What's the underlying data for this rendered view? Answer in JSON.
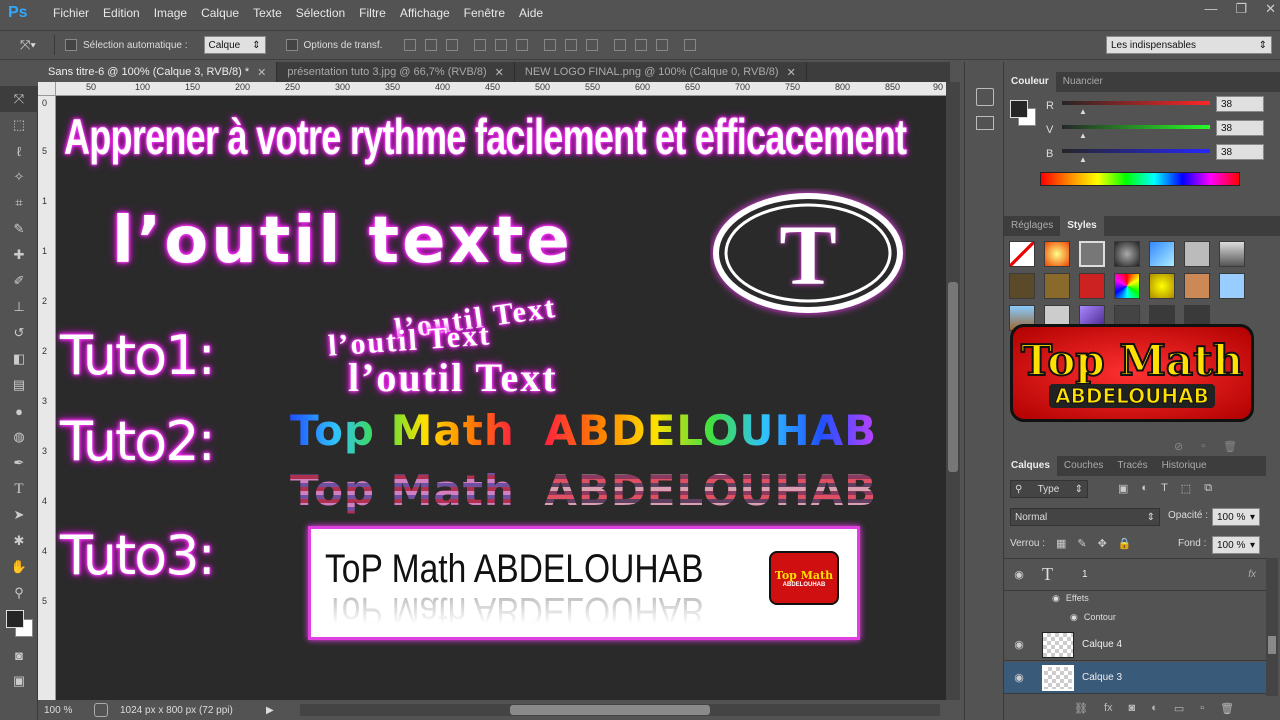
{
  "app": {
    "logo": "Ps"
  },
  "menu": [
    "Fichier",
    "Edition",
    "Image",
    "Calque",
    "Texte",
    "Sélection",
    "Filtre",
    "Affichage",
    "Fenêtre",
    "Aide"
  ],
  "window_controls": [
    "—",
    "❐",
    "✕"
  ],
  "options": {
    "auto_select_label": "Sélection automatique :",
    "auto_select_value": "Calque",
    "transform_label": "Options de transf.",
    "workspace": "Les indispensables"
  },
  "doc_tabs": [
    {
      "label": "Sans titre-6 @ 100% (Calque 3, RVB/8) *",
      "close": "✕",
      "active": true
    },
    {
      "label": "présentation tuto 3.jpg @ 66,7% (RVB/8)",
      "close": "✕",
      "active": false
    },
    {
      "label": "NEW LOGO FINAL.png @ 100% (Calque 0, RVB/8)",
      "close": "✕",
      "active": false
    }
  ],
  "ruler_h": [
    "50",
    "100",
    "150",
    "200",
    "250",
    "300",
    "350",
    "400",
    "450",
    "500",
    "550",
    "600",
    "650",
    "700",
    "750",
    "800",
    "850",
    "90"
  ],
  "ruler_v": [
    "0",
    "5",
    "1",
    "1",
    "2",
    "2",
    "3",
    "3",
    "4",
    "4",
    "5"
  ],
  "canvas": {
    "headline": "Apprener à votre rythme facilement et efficacement",
    "subtitle": "l’outil texte",
    "logo_letter": "T",
    "tuto1": "Tuto1:",
    "tuto2": "Tuto2:",
    "tuto3": "Tuto3:",
    "arc_texts": [
      "l’outil Text",
      "l’outil Text",
      "l’outil Text"
    ],
    "rainbow_top": "Top Math",
    "rainbow_name": "ABDELOUHAB",
    "pattern_top": "Top Math",
    "pattern_name": "ABDELOUHAB",
    "reflect_text": "ToP Math ABDELOUHAB",
    "mini_logo_top": "Top Math",
    "mini_logo_name": "ABDELOUHAB"
  },
  "status": {
    "zoom": "100 %",
    "doc_size": "1024 px x 800 px (72 ppi)"
  },
  "color_panel": {
    "tabs": [
      "Couleur",
      "Nuancier"
    ],
    "channels": [
      {
        "label": "R",
        "value": "38"
      },
      {
        "label": "V",
        "value": "38"
      },
      {
        "label": "B",
        "value": "38"
      }
    ]
  },
  "styles_panel": {
    "tabs": [
      "Réglages",
      "Styles"
    ]
  },
  "preview_logo": {
    "line1": "Top Math",
    "line2": "ABDELOUHAB"
  },
  "layers_panel": {
    "tabs": [
      "Calques",
      "Couches",
      "Tracés",
      "Historique"
    ],
    "filter": "Type",
    "blend_mode": "Normal",
    "opacity_label": "Opacité :",
    "opacity_value": "100 %",
    "lock_label": "Verrou :",
    "fill_label": "Fond :",
    "fill_value": "100 %",
    "layers": [
      {
        "name": "1",
        "type": "text",
        "fx": "fx"
      },
      {
        "name": "Effets",
        "type": "effect"
      },
      {
        "name": "Contour",
        "type": "effect"
      },
      {
        "name": "Calque 4",
        "type": "pixel"
      },
      {
        "name": "Calque 3",
        "type": "pixel",
        "selected": true
      }
    ]
  },
  "colors": {
    "accent_magenta": "#ff3cff",
    "logo_red": "#e01010",
    "logo_yellow": "#f8e000",
    "selected_layer": "#3a5a7a"
  }
}
